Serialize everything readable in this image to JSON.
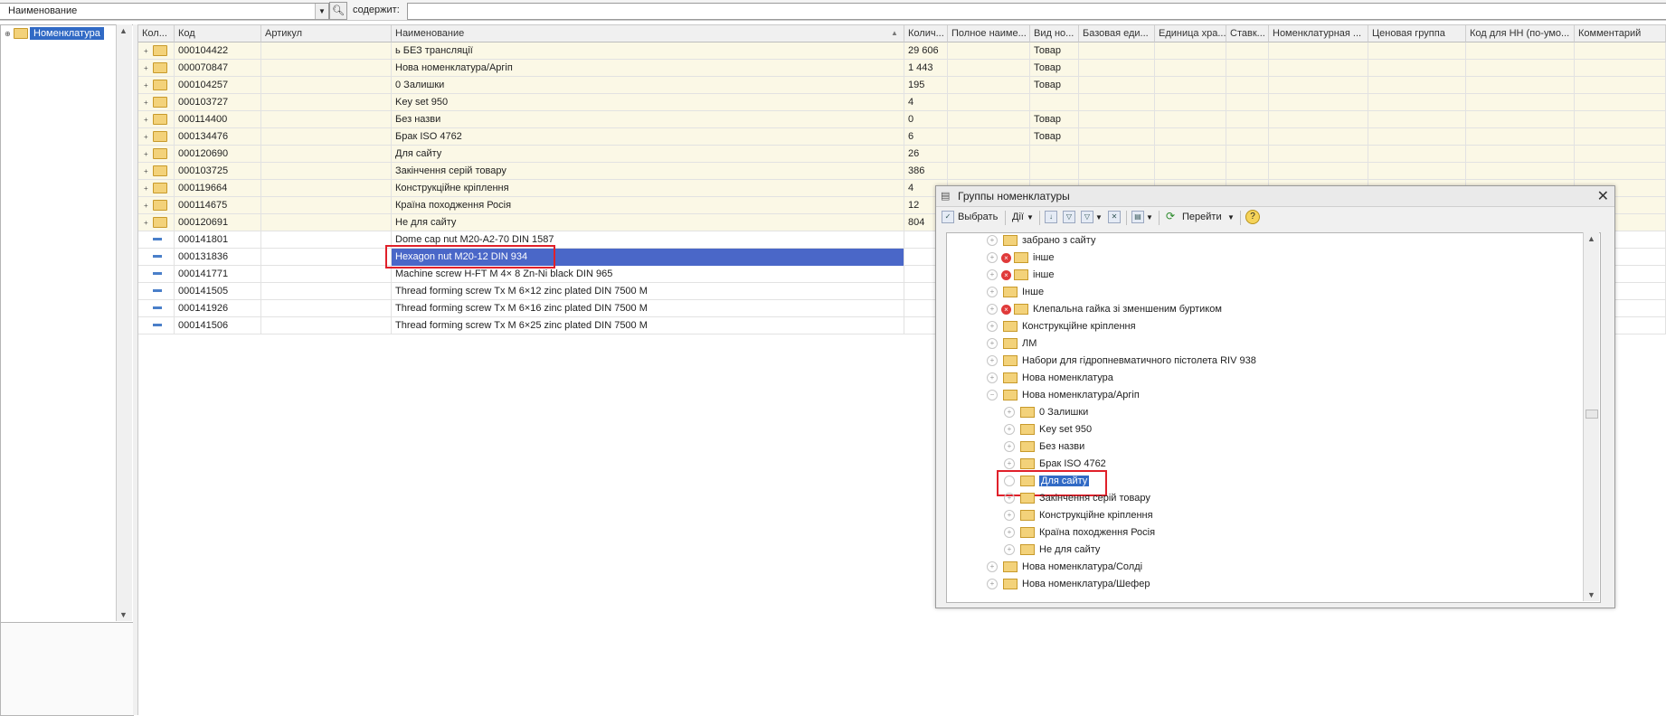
{
  "filter": {
    "field_value": "Наименование",
    "contains_label": "содержит:",
    "contains_value": ""
  },
  "left_tree": {
    "root_label": "Номенклатура"
  },
  "grid": {
    "columns": [
      "Кол...",
      "Код",
      "Артикул",
      "Наименование",
      "Колич...",
      "Полное наиме...",
      "Вид но...",
      "Базовая еди...",
      "Единица хра...",
      "Ставк...",
      "Номенклатурная ...",
      "Ценовая группа",
      "Код для НН (по-умо...",
      "Комментарий"
    ],
    "rows": [
      {
        "type": "folder",
        "code": "000104422",
        "article": "",
        "name": "ь БЕЗ трансляції",
        "qty": "29 606",
        "kind": "Товар"
      },
      {
        "type": "folder",
        "code": "000070847",
        "article": "",
        "name": "Нова номенклатура/Аргіп",
        "qty": "1 443",
        "kind": "Товар"
      },
      {
        "type": "folder",
        "code": "000104257",
        "article": "",
        "name": "0 Залишки",
        "qty": "195",
        "kind": "Товар"
      },
      {
        "type": "folder",
        "code": "000103727",
        "article": "",
        "name": "Key set 950",
        "qty": "4",
        "kind": ""
      },
      {
        "type": "folder",
        "code": "000114400",
        "article": "",
        "name": "Без назви",
        "qty": "0",
        "kind": "Товар"
      },
      {
        "type": "folder",
        "code": "000134476",
        "article": "",
        "name": "Брак ISO 4762",
        "qty": "6",
        "kind": "Товар"
      },
      {
        "type": "folder",
        "code": "000120690",
        "article": "",
        "name": "Для сайту",
        "qty": "26",
        "kind": ""
      },
      {
        "type": "folder",
        "code": "000103725",
        "article": "",
        "name": "Закінчення серій товару",
        "qty": "386",
        "kind": ""
      },
      {
        "type": "folder",
        "code": "000119664",
        "article": "",
        "name": "Конструкційне кріплення",
        "qty": "4",
        "kind": ""
      },
      {
        "type": "folder",
        "code": "000114675",
        "article": "",
        "name": "Країна походження Росія",
        "qty": "12",
        "kind": ""
      },
      {
        "type": "folder",
        "code": "000120691",
        "article": "",
        "name": "Не для сайту",
        "qty": "804",
        "kind": ""
      },
      {
        "type": "item",
        "code": "000141801",
        "article": "",
        "name": "Dome cap nut  M20-A2-70   DIN 1587",
        "qty": "",
        "kind": ""
      },
      {
        "type": "item",
        "code": "000131836",
        "article": "",
        "name": "Hexagon nut  M20-12   DIN 934",
        "qty": "",
        "kind": "",
        "selected": true
      },
      {
        "type": "item",
        "code": "000141771",
        "article": "",
        "name": "Machine screw  H-FT M 4× 8  Zn-Ni black  DIN 965",
        "qty": "",
        "kind": ""
      },
      {
        "type": "item",
        "code": "000141505",
        "article": "",
        "name": "Thread forming screw  Tx M 6×12  zinc plated  DIN 7500 M",
        "qty": "",
        "kind": ""
      },
      {
        "type": "item",
        "code": "000141926",
        "article": "",
        "name": "Thread forming screw  Tx M 6×16  zinc plated  DIN 7500 M",
        "qty": "",
        "kind": ""
      },
      {
        "type": "item",
        "code": "000141506",
        "article": "",
        "name": "Thread forming screw  Tx M 6×25  zinc plated  DIN 7500 M",
        "qty": "",
        "kind": ""
      }
    ]
  },
  "dialog": {
    "title": "Группы номенклатуры",
    "toolbar": {
      "select_label": "Выбрать",
      "actions_label": "Дії",
      "goto_label": "Перейти"
    },
    "tree": [
      {
        "label": "забрано з сайту",
        "level": 0,
        "deleted": false,
        "expanded": false
      },
      {
        "label": "інше",
        "level": 0,
        "deleted": true,
        "expanded": false
      },
      {
        "label": "інше",
        "level": 0,
        "deleted": true,
        "expanded": false
      },
      {
        "label": "Інше",
        "level": 0,
        "deleted": false,
        "expanded": false
      },
      {
        "label": "Клепальна гайка зі зменшеним буртиком",
        "level": 0,
        "deleted": true,
        "expanded": false
      },
      {
        "label": "Конструкційне кріплення",
        "level": 0,
        "deleted": false,
        "expanded": false
      },
      {
        "label": "ЛМ",
        "level": 0,
        "deleted": false,
        "expanded": false
      },
      {
        "label": "Набори для гідропневматичного пістолета RIV 938",
        "level": 0,
        "deleted": false,
        "expanded": false
      },
      {
        "label": "Нова номенклатура",
        "level": 0,
        "deleted": false,
        "expanded": false
      },
      {
        "label": "Нова номенклатура/Аргіп",
        "level": 0,
        "deleted": false,
        "expanded": true
      },
      {
        "label": "0 Залишки",
        "level": 1,
        "deleted": false,
        "expanded": false
      },
      {
        "label": "Key set 950",
        "level": 1,
        "deleted": false,
        "expanded": false
      },
      {
        "label": "Без назви",
        "level": 1,
        "deleted": false,
        "expanded": false
      },
      {
        "label": "Брак ISO 4762",
        "level": 1,
        "deleted": false,
        "expanded": false
      },
      {
        "label": "Для сайту",
        "level": 1,
        "deleted": false,
        "expanded": false,
        "selected": true
      },
      {
        "label": "Закінчення серій товару",
        "level": 1,
        "deleted": false,
        "expanded": false
      },
      {
        "label": "Конструкційне кріплення",
        "level": 1,
        "deleted": false,
        "expanded": false
      },
      {
        "label": "Країна походження Росія",
        "level": 1,
        "deleted": false,
        "expanded": false
      },
      {
        "label": "Не для сайту",
        "level": 1,
        "deleted": false,
        "expanded": false
      },
      {
        "label": "Нова номенклатура/Солді",
        "level": 0,
        "deleted": false,
        "expanded": false
      },
      {
        "label": "Нова номенклатура/Шефер",
        "level": 0,
        "deleted": false,
        "expanded": false
      }
    ]
  },
  "colors": {
    "selection": "#4a67c8",
    "folder_row_bg": "#fbf8e6",
    "highlight_box": "#e0202a"
  }
}
